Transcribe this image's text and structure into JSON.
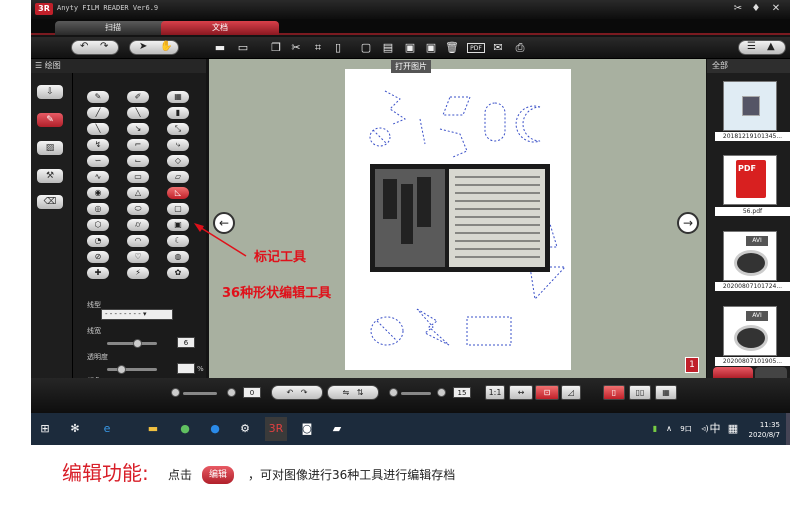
{
  "app": {
    "title": "Anyty FILM READER Ver6.9",
    "logo": "3R",
    "tabs": [
      "扫描",
      "文档"
    ],
    "panel_title": "绘图",
    "tooltip": "打开图片",
    "all_label": "全部"
  },
  "toolpanel": {
    "line_type_label": "线型",
    "line_width_label": "线宽",
    "line_width_value": "6",
    "opacity_label": "透明度",
    "opacity_unit": "%",
    "color_label": "颜色"
  },
  "files": [
    {
      "name": "20181219101345...",
      "type": "image"
    },
    {
      "name": "56.pdf",
      "type": "pdf",
      "badge": "PDF"
    },
    {
      "name": "20200807101724...",
      "type": "avi",
      "badge": "AVI"
    },
    {
      "name": "20200807101905...",
      "type": "avi",
      "badge": "AVI"
    }
  ],
  "bottombar": {
    "brightness_value": "0",
    "zoom_value": "15",
    "page_badge": "1"
  },
  "taskbar": {
    "time": "11:35",
    "date": "2020/8/7",
    "lang": "中",
    "volume": "9口"
  },
  "annotations": {
    "mark_tool": "标记工具",
    "shape_tools": "36种形状编辑工具"
  },
  "caption": {
    "title": "编辑功能:",
    "click": "点击",
    "button_label": "编辑",
    "rest": "，可对图像进行36种工具进行编辑存档"
  }
}
